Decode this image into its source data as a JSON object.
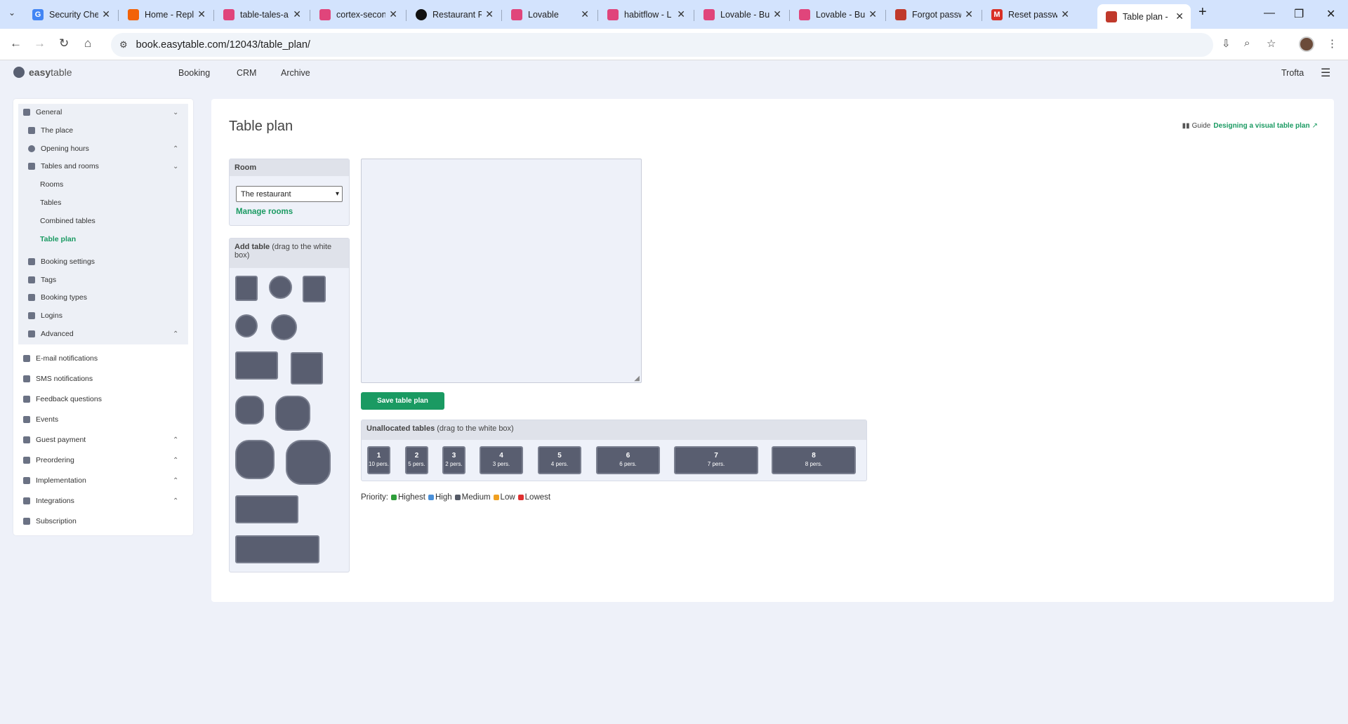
{
  "browser": {
    "tabs": [
      {
        "title": "Security Che",
        "icon": "google-icon",
        "color": "#4285f4"
      },
      {
        "title": "Home - Repl",
        "icon": "replit-icon",
        "color": "#f26207"
      },
      {
        "title": "table-tales-a",
        "icon": "lovable-icon",
        "color": "#e0457b"
      },
      {
        "title": "cortex-secon",
        "icon": "lovable-icon",
        "color": "#e0457b"
      },
      {
        "title": "Restaurant R",
        "icon": "openai-icon",
        "color": "#111111"
      },
      {
        "title": "Lovable",
        "icon": "lovable-icon",
        "color": "#e0457b"
      },
      {
        "title": "habitflow - L",
        "icon": "lovable-icon",
        "color": "#e0457b"
      },
      {
        "title": "Lovable - Bu",
        "icon": "lovable-icon",
        "color": "#e0457b"
      },
      {
        "title": "Lovable - Bu",
        "icon": "lovable-icon",
        "color": "#e0457b"
      },
      {
        "title": "Forgot passw",
        "icon": "easytable-icon",
        "color": "#c0392b"
      },
      {
        "title": "Reset passwo",
        "icon": "gmail-icon",
        "color": "#d93025"
      },
      {
        "title": "Table plan - ",
        "icon": "easytable-icon",
        "color": "#c0392b"
      }
    ],
    "url": "book.easytable.com/12043/table_plan/"
  },
  "app": {
    "logo_bold": "easy",
    "logo_light": "table",
    "nav": [
      "Booking",
      "CRM",
      "Archive"
    ],
    "user": "Trofta"
  },
  "sidebar": {
    "group": [
      {
        "label": "General",
        "icon": "gear-icon"
      },
      {
        "label": "The place",
        "icon": "store-icon"
      },
      {
        "label": "Opening hours",
        "icon": "clock-icon"
      },
      {
        "label": "Tables and rooms",
        "icon": "chair-icon"
      },
      {
        "label": "Rooms"
      },
      {
        "label": "Tables"
      },
      {
        "label": "Combined tables"
      },
      {
        "label": "Table plan"
      },
      {
        "label": "Booking settings",
        "icon": "calendar-check-icon"
      },
      {
        "label": "Tags",
        "icon": "tag-icon"
      },
      {
        "label": "Booking types",
        "icon": "calendar-edit-icon"
      },
      {
        "label": "Logins",
        "icon": "users-icon"
      },
      {
        "label": "Advanced",
        "icon": "gears-icon"
      }
    ],
    "items": [
      {
        "label": "E-mail notifications",
        "icon": "envelope-icon"
      },
      {
        "label": "SMS notifications",
        "icon": "chat-icon"
      },
      {
        "label": "Feedback questions",
        "icon": "comment-icon"
      },
      {
        "label": "Events",
        "icon": "calendar-icon"
      },
      {
        "label": "Guest payment",
        "icon": "credit-card-icon"
      },
      {
        "label": "Preordering",
        "icon": "cart-icon"
      },
      {
        "label": "Implementation",
        "icon": "code-icon"
      },
      {
        "label": "Integrations",
        "icon": "plug-icon"
      },
      {
        "label": "Subscription",
        "icon": "subscription-icon"
      }
    ]
  },
  "main": {
    "title": "Table plan",
    "guide_label": "Guide",
    "guide_link": "Designing a visual table plan",
    "room_heading": "Room",
    "room_select": "The restaurant",
    "manage_rooms": "Manage rooms",
    "add_table_bold": "Add table",
    "add_table_rest": "(drag to the white box)",
    "save_button": "Save table plan",
    "unallocated_bold": "Unallocated tables",
    "unallocated_rest": "(drag to the white box)",
    "unallocated_tables": [
      {
        "number": "1",
        "persons": "10 pers."
      },
      {
        "number": "2",
        "persons": "5 pers."
      },
      {
        "number": "3",
        "persons": "2 pers."
      },
      {
        "number": "4",
        "persons": "3 pers."
      },
      {
        "number": "5",
        "persons": "4 pers."
      },
      {
        "number": "6",
        "persons": "6 pers."
      },
      {
        "number": "7",
        "persons": "7 pers."
      },
      {
        "number": "8",
        "persons": "8 pers."
      }
    ],
    "priority_label": "Priority:",
    "priority_levels": [
      {
        "label": "Highest",
        "color": "#2e9e3a"
      },
      {
        "label": "High",
        "color": "#4a90d9"
      },
      {
        "label": "Medium",
        "color": "#555a66"
      },
      {
        "label": "Low",
        "color": "#f0a020"
      },
      {
        "label": "Lowest",
        "color": "#e03030"
      }
    ]
  }
}
